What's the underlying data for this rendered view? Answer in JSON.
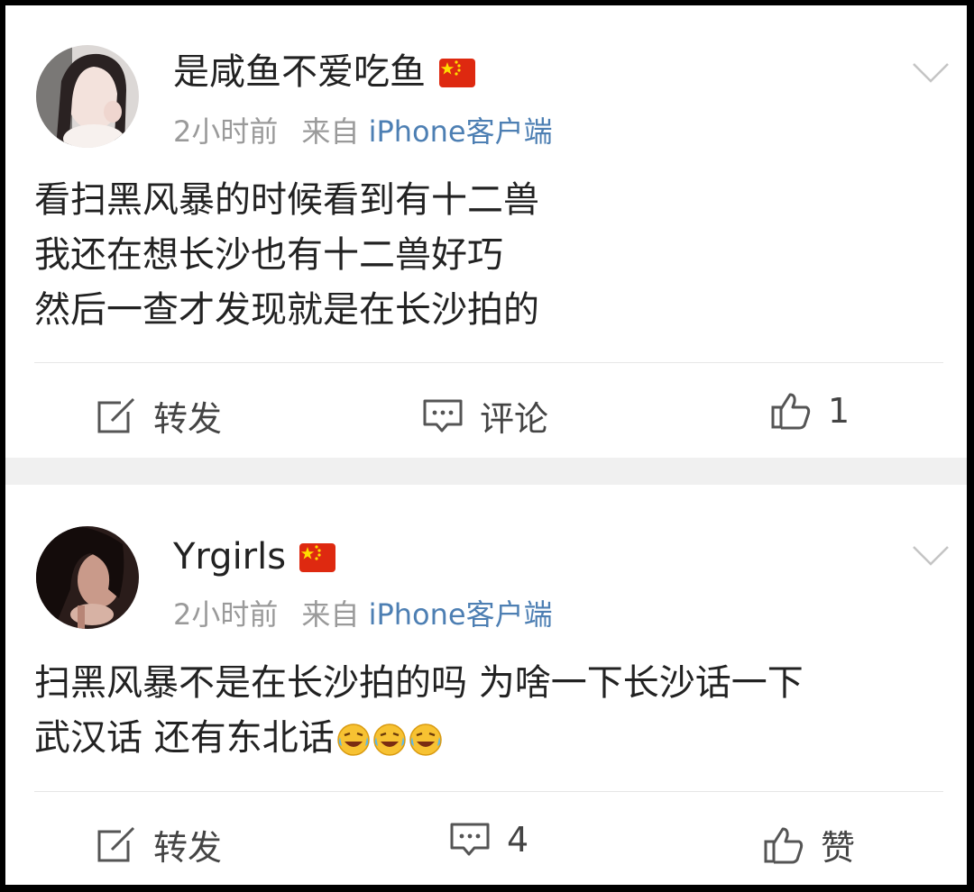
{
  "posts": [
    {
      "username": "是咸鱼不爱吃鱼",
      "time": "2小时前",
      "source_prefix": "来自",
      "source": "iPhone客户端",
      "lines": [
        "看扫黑风暴的时候看到有十二兽",
        "我还在想长沙也有十二兽好巧",
        "然后一查才发现就是在长沙拍的"
      ],
      "actions": {
        "repost": "转发",
        "comment": "评论",
        "like": "1"
      }
    },
    {
      "username": "Yrgirls",
      "time": "2小时前",
      "source_prefix": "来自",
      "source": "iPhone客户端",
      "lines": [
        "扫黑风暴不是在长沙拍的吗  为啥一下长沙话一下",
        "武汉话  还有东北话"
      ],
      "emoji_count": 3,
      "emoji_icon": "laughing-crying-emoji",
      "actions": {
        "repost": "转发",
        "comment": "4",
        "like": "赞"
      }
    }
  ],
  "colors": {
    "source_link": "#4d7fb3",
    "meta_gray": "#9a9a9a",
    "text": "#222222",
    "separator": "#f0f0f0",
    "flag_red": "#de2910",
    "flag_star": "#ffde00"
  },
  "icons": {
    "repost": "edit-square-icon",
    "comment": "comment-bubble-icon",
    "like": "thumbs-up-icon",
    "expand": "chevron-down-icon",
    "flag": "china-flag-icon"
  }
}
